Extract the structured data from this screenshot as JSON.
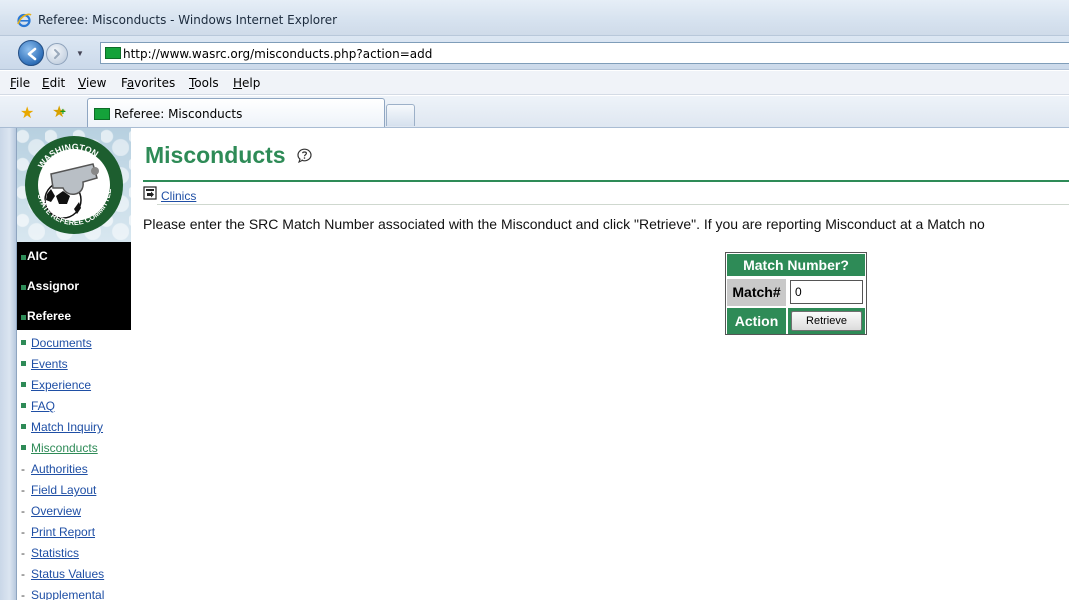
{
  "window": {
    "title": "Referee: Misconducts - Windows Internet Explorer"
  },
  "address_bar": {
    "url": "http://www.wasrc.org/misconducts.php?action=add"
  },
  "menu": {
    "items": [
      {
        "label": "File",
        "underline": "F",
        "rest": "ile"
      },
      {
        "label": "Edit",
        "underline": "E",
        "rest": "dit"
      },
      {
        "label": "View",
        "underline": "V",
        "rest": "iew"
      },
      {
        "label": "Favorites",
        "underline": "a",
        "pre": "F",
        "rest": "vorites"
      },
      {
        "label": "Tools",
        "underline": "T",
        "rest": "ools"
      },
      {
        "label": "Help",
        "underline": "H",
        "rest": "elp"
      }
    ]
  },
  "tab": {
    "label": "Referee: Misconducts"
  },
  "sidebar": {
    "logo_text_top": "WASHINGTON",
    "logo_text_bottom": "STATE REFEREE COMMITTEE",
    "dark_items": [
      {
        "label": "AIC"
      },
      {
        "label": "Assignor"
      },
      {
        "label": "Referee"
      }
    ],
    "links": [
      {
        "label": "Documents",
        "marker": "square"
      },
      {
        "label": "Events",
        "marker": "square"
      },
      {
        "label": "Experience",
        "marker": "square"
      },
      {
        "label": "FAQ",
        "marker": "square"
      },
      {
        "label": "Match Inquiry",
        "marker": "square"
      },
      {
        "label": "Misconducts",
        "marker": "square",
        "active": true
      },
      {
        "label": "Authorities",
        "marker": "dash"
      },
      {
        "label": "Field Layout",
        "marker": "dash"
      },
      {
        "label": "Overview",
        "marker": "dash"
      },
      {
        "label": "Print Report",
        "marker": "dash"
      },
      {
        "label": "Statistics",
        "marker": "dash"
      },
      {
        "label": "Status Values",
        "marker": "dash"
      },
      {
        "label": "Supplemental",
        "marker": "dash"
      }
    ]
  },
  "main": {
    "heading": "Misconducts",
    "clinics_link": "Clinics",
    "instructions": "Please enter the SRC Match Number associated with the Misconduct and click \"Retrieve\". If you are reporting Misconduct at a Match no",
    "form": {
      "header": "Match Number?",
      "match_label": "Match#",
      "match_value": "0",
      "action_label": "Action",
      "button_label": "Retrieve"
    }
  },
  "colors": {
    "accent_green": "#2e8b57",
    "link_blue": "#1f4fa5"
  }
}
